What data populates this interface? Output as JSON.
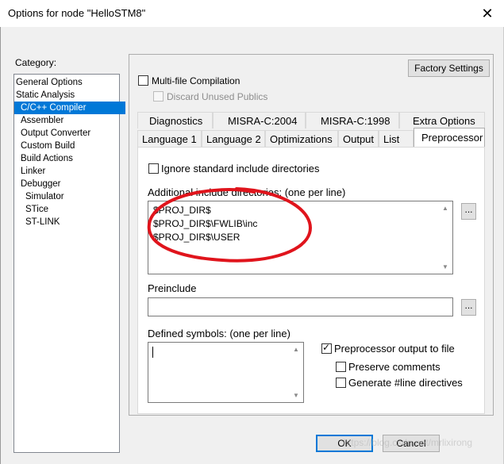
{
  "window": {
    "title": "Options for node \"HelloSTM8\"",
    "close_glyph": "✕"
  },
  "category": {
    "label": "Category:",
    "items": [
      {
        "label": "General Options"
      },
      {
        "label": "Static Analysis"
      },
      {
        "label": "C/C++ Compiler",
        "selected": true
      },
      {
        "label": "Assembler"
      },
      {
        "label": "Output Converter"
      },
      {
        "label": "Custom Build"
      },
      {
        "label": "Build Actions"
      },
      {
        "label": "Linker"
      },
      {
        "label": "Debugger"
      },
      {
        "label": "Simulator"
      },
      {
        "label": "STice"
      },
      {
        "label": "ST-LINK"
      }
    ]
  },
  "panel": {
    "factory_settings": "Factory Settings",
    "multi_file": {
      "label": "Multi-file Compilation",
      "checked": false
    },
    "discard_unused": {
      "label": "Discard Unused Publics",
      "checked": false,
      "disabled": true
    }
  },
  "tabs": {
    "upper": [
      "Diagnostics",
      "MISRA-C:2004",
      "MISRA-C:1998",
      "Extra Options"
    ],
    "lower": [
      "Language 1",
      "Language 2",
      "Optimizations",
      "Output",
      "List",
      "Preprocessor"
    ],
    "active": "Preprocessor"
  },
  "preprocessor": {
    "ignore_std": {
      "label": "Ignore standard include directories",
      "checked": false
    },
    "include_label": "Additional include directories: (one per line)",
    "include_lines": [
      "$PROJ_DIR$",
      "$PROJ_DIR$\\FWLIB\\inc",
      "$PROJ_DIR$\\USER"
    ],
    "browse_glyph": "...",
    "preinclude_label": "Preinclude",
    "preinclude_value": "",
    "defined_label": "Defined symbols: (one per line)",
    "defined_value": "",
    "preproc_output": {
      "label": "Preprocessor output to file",
      "checked": true
    },
    "preserve_comments": {
      "label": "Preserve comments",
      "checked": false
    },
    "line_directives": {
      "label": "Generate #line directives",
      "checked": false
    }
  },
  "buttons": {
    "ok": "OK",
    "cancel": "Cancel"
  },
  "annotation": {
    "color": "#e0141c"
  },
  "watermark": "https://blog.csdn.net/mrlixirong"
}
